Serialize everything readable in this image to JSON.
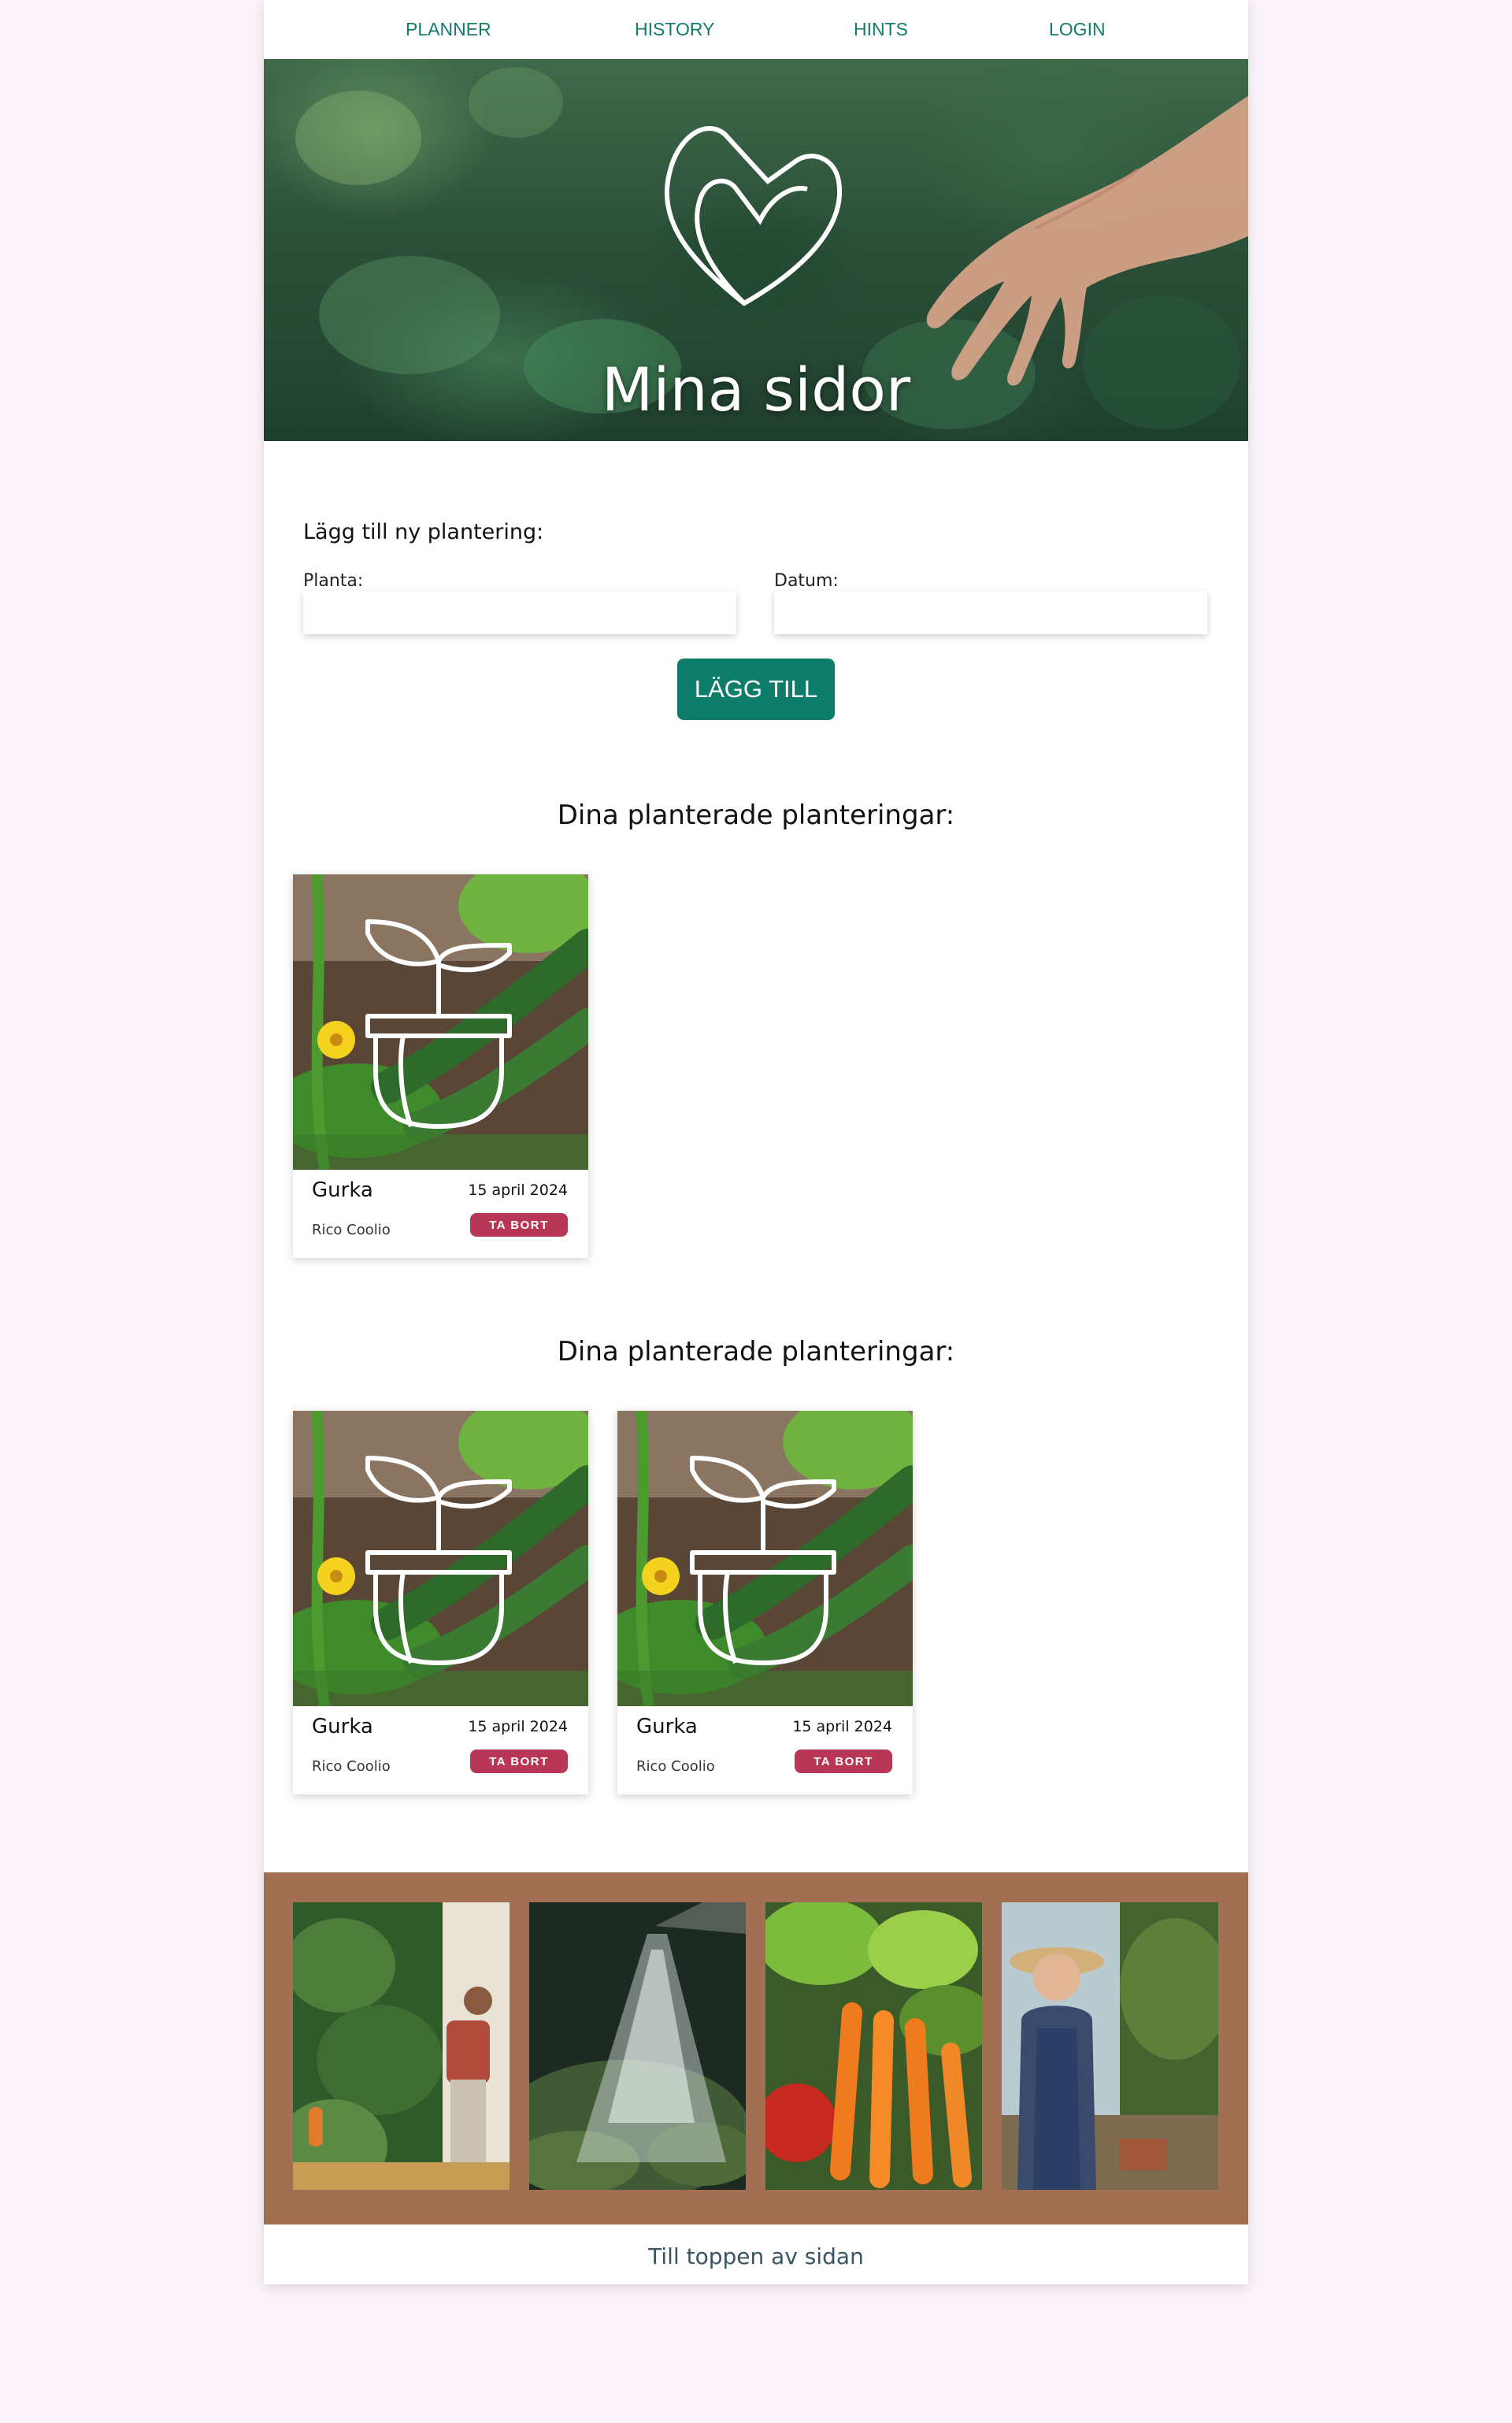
{
  "nav": {
    "items": [
      {
        "label": "PLANNER"
      },
      {
        "label": "HISTORY"
      },
      {
        "label": "HINTS"
      },
      {
        "label": "LOGIN"
      }
    ]
  },
  "hero": {
    "title": "Mina sidor",
    "logo_icon": "heart-leaf-logo-icon"
  },
  "form": {
    "heading": "Lägg till ny plantering:",
    "plant_label": "Planta:",
    "plant_value": "",
    "date_label": "Datum:",
    "date_value": "",
    "submit_label": "LÄGG TILL"
  },
  "sections": [
    {
      "title": "Dina planterade planteringar:",
      "cards": [
        {
          "name": "Gurka",
          "date": "15 april 2024",
          "owner": "Rico Coolio",
          "remove_label": "TA BORT",
          "icon": "plant-pot-icon"
        }
      ]
    },
    {
      "title": "Dina planterade planteringar:",
      "cards": [
        {
          "name": "Gurka",
          "date": "15 april 2024",
          "owner": "Rico Coolio",
          "remove_label": "TA BORT",
          "icon": "plant-pot-icon"
        },
        {
          "name": "Gurka",
          "date": "15 april 2024",
          "owner": "Rico Coolio",
          "remove_label": "TA BORT",
          "icon": "plant-pot-icon"
        }
      ]
    }
  ],
  "footer": {
    "back_to_top_label": "Till toppen av sidan"
  },
  "colors": {
    "accent": "#0d7d69",
    "nav_link": "#157a68",
    "remove": "#b83656",
    "gallery_bg": "#a36f53",
    "page_bg": "#fbf2fa"
  }
}
